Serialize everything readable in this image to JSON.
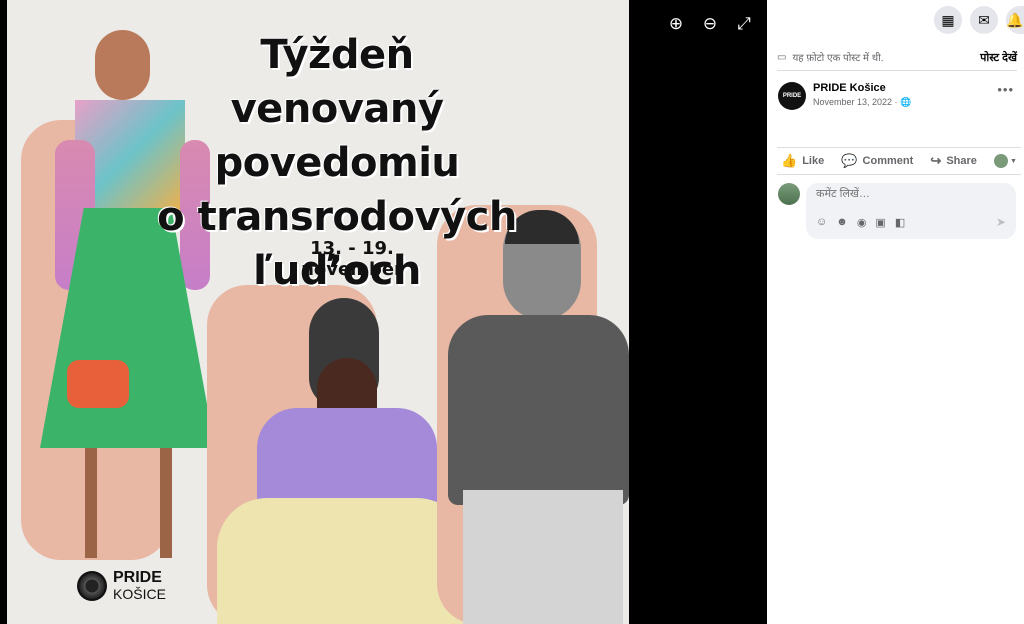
{
  "poster": {
    "title_lines": [
      "Týždeň venovaný",
      "povedomiu",
      "o transrodových",
      "ľuď’och"
    ],
    "dates": "13. - 19. november",
    "logo_line1": "PRIDE",
    "logo_line2": "KOŠICE"
  },
  "viewer_tools": [
    {
      "name": "zoom-in-icon",
      "glyph": "⊕"
    },
    {
      "name": "zoom-out-icon",
      "glyph": "⊖"
    },
    {
      "name": "fullscreen-icon",
      "glyph": "⤢"
    }
  ],
  "topbar": {
    "menu_icon": "grid-icon",
    "messenger_icon": "messenger-icon",
    "notifications_icon": "bell-icon"
  },
  "note": {
    "text": "यह फ़ोटो एक पोस्ट में थी.",
    "link": "पोस्ट देखें"
  },
  "author": {
    "name": "PRIDE Košice",
    "date": "November 13, 2022 ·",
    "avatar_text": "PRIDE"
  },
  "actions": {
    "like": "Like",
    "comment": "Comment",
    "share": "Share"
  },
  "composer": {
    "placeholder": "कमेंट लिखें…"
  }
}
